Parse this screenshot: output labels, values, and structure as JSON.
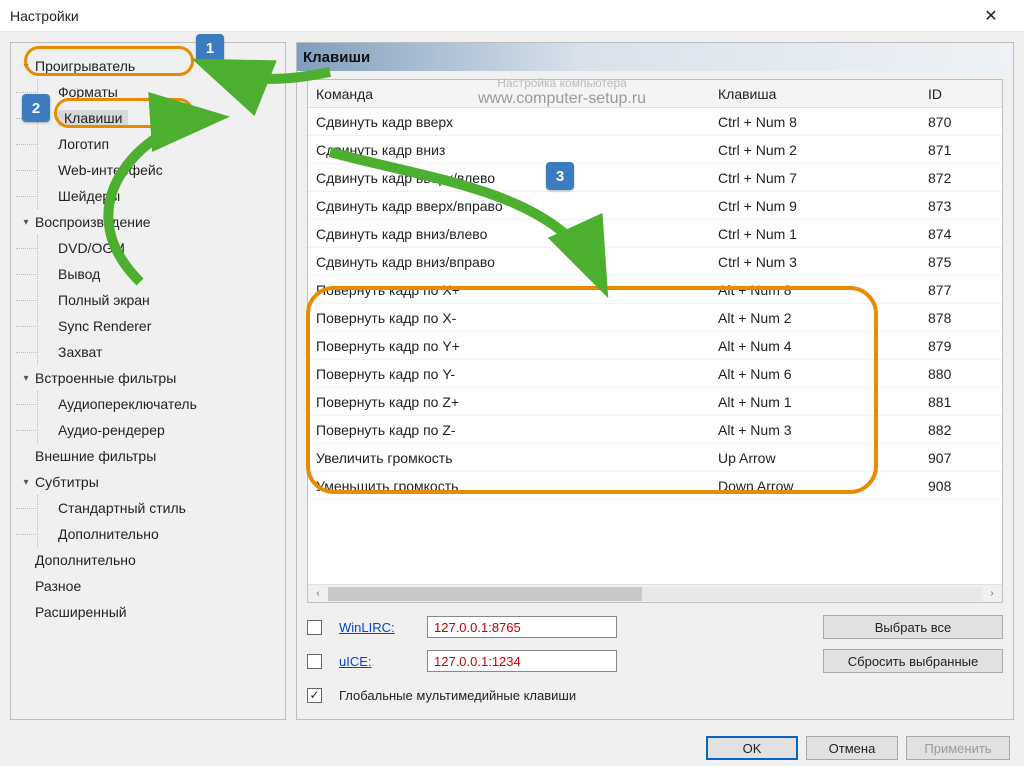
{
  "window": {
    "title": "Настройки"
  },
  "watermark": {
    "line1": "Настройка компьютера",
    "line2": "www.computer-setup.ru"
  },
  "tree": [
    {
      "label": "Проигрыватель",
      "expandable": true,
      "children": [
        {
          "label": "Форматы"
        },
        {
          "label": "Клавиши",
          "selected": true
        },
        {
          "label": "Логотип"
        },
        {
          "label": "Web-интерфейс"
        },
        {
          "label": "Шейдеры"
        }
      ]
    },
    {
      "label": "Воспроизведение",
      "expandable": true,
      "children": [
        {
          "label": "DVD/OGM"
        },
        {
          "label": "Вывод"
        },
        {
          "label": "Полный экран"
        },
        {
          "label": "Sync Renderer"
        },
        {
          "label": "Захват"
        }
      ]
    },
    {
      "label": "Встроенные фильтры",
      "expandable": true,
      "children": [
        {
          "label": "Аудиопереключатель"
        },
        {
          "label": "Аудио-рендерер"
        }
      ]
    },
    {
      "label": "Внешние фильтры",
      "expandable": false
    },
    {
      "label": "Субтитры",
      "expandable": true,
      "children": [
        {
          "label": "Стандартный стиль"
        },
        {
          "label": "Дополнительно"
        }
      ]
    },
    {
      "label": "Дополнительно",
      "expandable": false
    },
    {
      "label": "Разное",
      "expandable": false
    },
    {
      "label": "Расширенный",
      "expandable": false
    }
  ],
  "section_title": "Клавиши",
  "table": {
    "columns": {
      "command": "Команда",
      "key": "Клавиша",
      "id": "ID"
    },
    "rows": [
      {
        "command": "Сдвинуть кадр вверх",
        "key": "Ctrl + Num 8",
        "id": "870"
      },
      {
        "command": "Сдвинуть кадр вниз",
        "key": "Ctrl + Num 2",
        "id": "871"
      },
      {
        "command": "Сдвинуть кадр вверх/влево",
        "key": "Ctrl + Num 7",
        "id": "872"
      },
      {
        "command": "Сдвинуть кадр вверх/вправо",
        "key": "Ctrl + Num 9",
        "id": "873"
      },
      {
        "command": "Сдвинуть кадр вниз/влево",
        "key": "Ctrl + Num 1",
        "id": "874"
      },
      {
        "command": "Сдвинуть кадр вниз/вправо",
        "key": "Ctrl + Num 3",
        "id": "875"
      },
      {
        "command": "Повернуть кадр по X+",
        "key": "Alt + Num 8",
        "id": "877"
      },
      {
        "command": "Повернуть кадр по X-",
        "key": "Alt + Num 2",
        "id": "878"
      },
      {
        "command": "Повернуть кадр по Y+",
        "key": "Alt + Num 4",
        "id": "879"
      },
      {
        "command": "Повернуть кадр по Y-",
        "key": "Alt + Num 6",
        "id": "880"
      },
      {
        "command": "Повернуть кадр по Z+",
        "key": "Alt + Num 1",
        "id": "881"
      },
      {
        "command": "Повернуть кадр по Z-",
        "key": "Alt + Num 3",
        "id": "882"
      },
      {
        "command": "Увеличить громкость",
        "key": "Up Arrow",
        "id": "907"
      },
      {
        "command": "Уменьшить громкость",
        "key": "Down Arrow",
        "id": "908"
      }
    ]
  },
  "controls": {
    "winlirc_label": "WinLIRC:",
    "winlirc_value": "127.0.0.1:8765",
    "uice_label": "uICE:",
    "uice_value": "127.0.0.1:1234",
    "global_keys_label": "Глобальные мультимедийные клавиши",
    "select_all": "Выбрать все",
    "reset_selected": "Сбросить выбранные"
  },
  "footer": {
    "ok": "OK",
    "cancel": "Отмена",
    "apply": "Применить"
  },
  "anno": {
    "b1": "1",
    "b2": "2",
    "b3": "3"
  }
}
